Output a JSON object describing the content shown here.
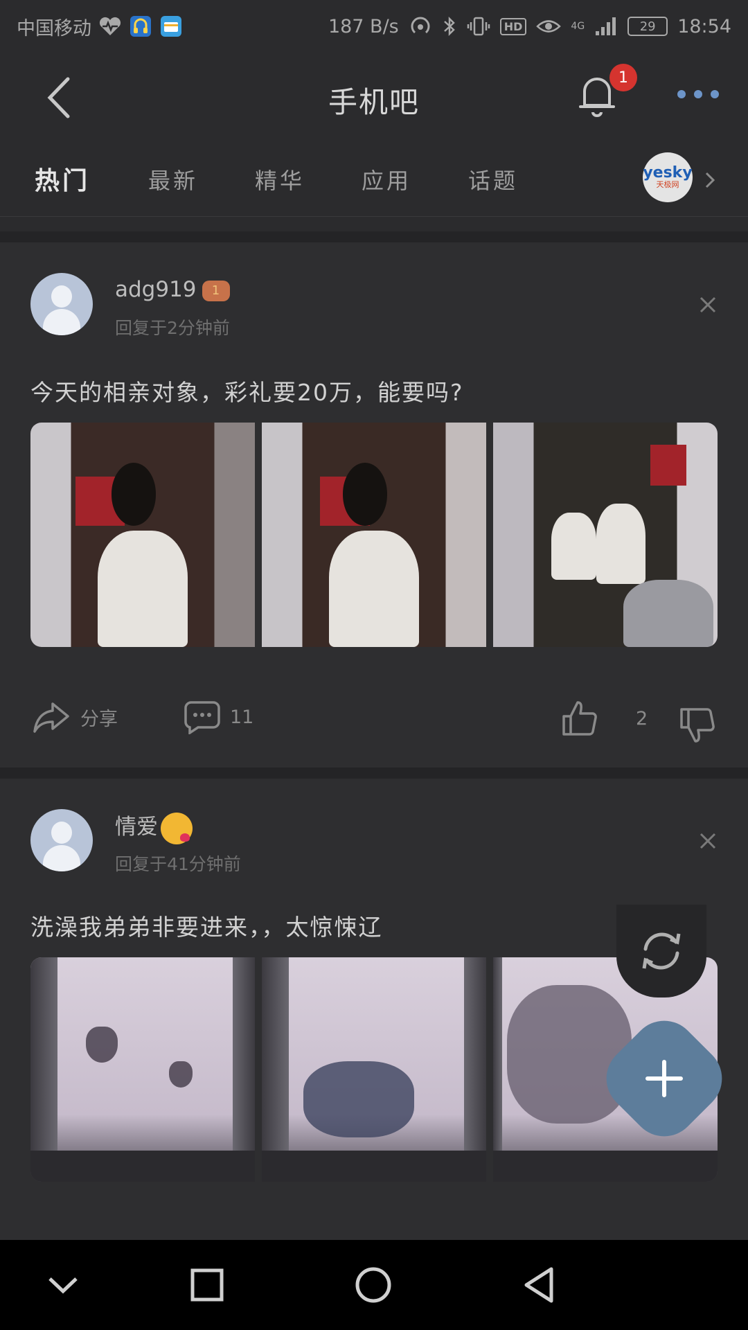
{
  "status_bar": {
    "carrier": "中国移动",
    "net_speed": "187 B/s",
    "hd": "HD",
    "signal_label": "4G",
    "battery": "29",
    "time": "18:54"
  },
  "header": {
    "title": "手机吧",
    "notification_count": "1"
  },
  "tabs": [
    {
      "label": "热门",
      "active": true
    },
    {
      "label": "最新",
      "active": false
    },
    {
      "label": "精华",
      "active": false
    },
    {
      "label": "应用",
      "active": false
    },
    {
      "label": "话题",
      "active": false
    }
  ],
  "partner_logo": {
    "main": "yesky",
    "sub": "天极网"
  },
  "posts": [
    {
      "username": "adg919",
      "level": "1",
      "reply_time": "回复于2分钟前",
      "text": "今天的相亲对象，彩礼要20万，能要吗?",
      "share_label": "分享",
      "comment_count": "11",
      "like_count": "2"
    },
    {
      "username": "情爱",
      "reply_time": "回复于41分钟前",
      "text": "洗澡我弟弟非要进来，，太惊悚辽"
    }
  ],
  "colors": {
    "background": "#2c2c2e",
    "badge": "#d5342f",
    "accent_blue": "#6d95c9",
    "fab": "#5d7d9b"
  }
}
